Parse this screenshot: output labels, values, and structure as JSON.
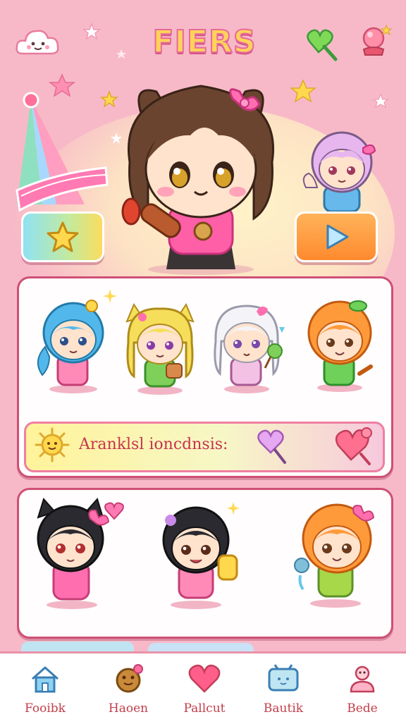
{
  "header": {
    "title": "FIERS"
  },
  "banner": {
    "text": "Aranklsl ioncdnsis:"
  },
  "nav": {
    "items": [
      {
        "label": "Fooibk",
        "icon": "home-icon"
      },
      {
        "label": "Haoen",
        "icon": "cookie-icon"
      },
      {
        "label": "Pallcut",
        "icon": "heart-icon"
      },
      {
        "label": "Bautik",
        "icon": "tv-icon"
      },
      {
        "label": "Bede",
        "icon": "profile-icon"
      }
    ]
  },
  "colors": {
    "background": "#f7b9c8",
    "panel_border": "#cf4f76",
    "title_fill": "#ffd35a",
    "nav_label": "#c23e4a",
    "play_button": "#ff8a2e"
  }
}
